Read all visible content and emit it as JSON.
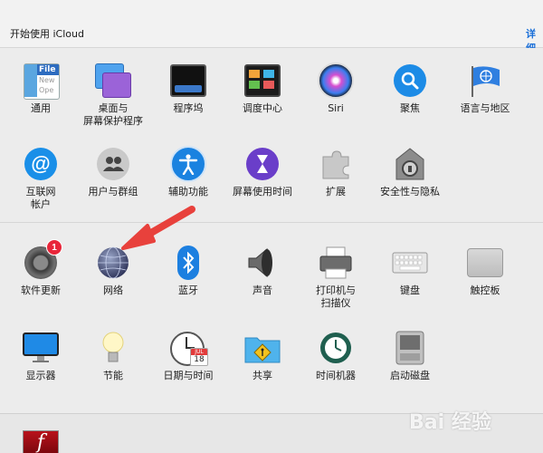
{
  "icloud": {
    "text": "开始使用 iCloud",
    "details": "详细"
  },
  "row1": [
    {
      "label": "通用",
      "icon": "general-icon"
    },
    {
      "label": "桌面与\n屏幕保护程序",
      "icon": "desktop-screensaver-icon"
    },
    {
      "label": "程序坞",
      "icon": "dock-icon"
    },
    {
      "label": "调度中心",
      "icon": "mission-control-icon"
    },
    {
      "label": "Siri",
      "icon": "siri-icon"
    },
    {
      "label": "聚焦",
      "icon": "spotlight-icon"
    },
    {
      "label": "语言与地区",
      "icon": "language-region-icon"
    }
  ],
  "row2": [
    {
      "label": "互联网\n帐户",
      "icon": "internet-accounts-icon"
    },
    {
      "label": "用户与群组",
      "icon": "users-groups-icon"
    },
    {
      "label": "辅助功能",
      "icon": "accessibility-icon"
    },
    {
      "label": "屏幕使用时间",
      "icon": "screen-time-icon"
    },
    {
      "label": "扩展",
      "icon": "extensions-icon"
    },
    {
      "label": "安全性与隐私",
      "icon": "security-privacy-icon"
    }
  ],
  "row3": [
    {
      "label": "软件更新",
      "icon": "software-update-icon",
      "badge": "1"
    },
    {
      "label": "网络",
      "icon": "network-icon"
    },
    {
      "label": "蓝牙",
      "icon": "bluetooth-icon"
    },
    {
      "label": "声音",
      "icon": "sound-icon"
    },
    {
      "label": "打印机与\n扫描仪",
      "icon": "printers-scanners-icon"
    },
    {
      "label": "键盘",
      "icon": "keyboard-icon"
    },
    {
      "label": "触控板",
      "icon": "trackpad-icon"
    }
  ],
  "row4": [
    {
      "label": "显示器",
      "icon": "displays-icon"
    },
    {
      "label": "节能",
      "icon": "energy-saver-icon"
    },
    {
      "label": "日期与时间",
      "icon": "date-time-icon",
      "cal_month": "JUL",
      "cal_day": "18"
    },
    {
      "label": "共享",
      "icon": "sharing-icon"
    },
    {
      "label": "时间机器",
      "icon": "time-machine-icon"
    },
    {
      "label": "启动磁盘",
      "icon": "startup-disk-icon"
    }
  ],
  "general_icon_text": {
    "line1": "File",
    "line2": "New",
    "line3": "Ope"
  },
  "flash_glyph": "f",
  "watermark": "Bai 经验",
  "colors": {
    "accent_arrow": "#e8413c",
    "link": "#1a6fd8",
    "badge": "#e8263a"
  }
}
